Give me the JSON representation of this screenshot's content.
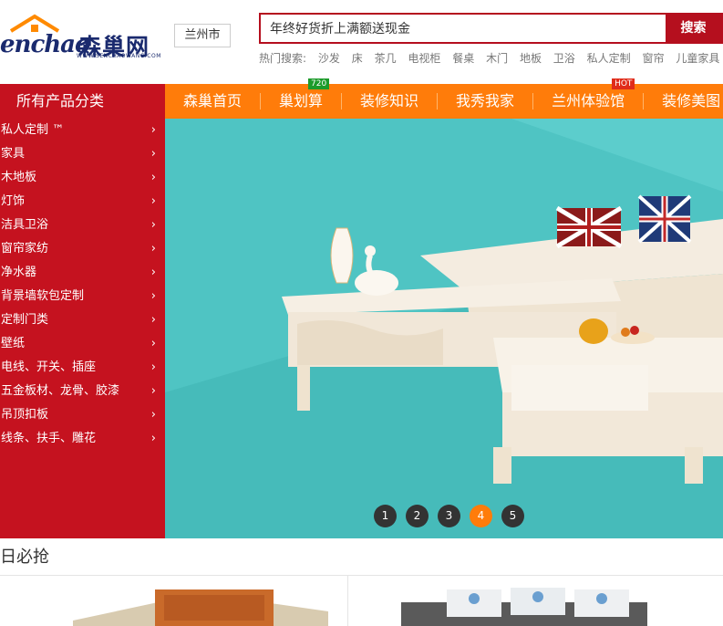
{
  "logo": {
    "english": "enchao",
    "chinese": "森巢网",
    "url": "WWW.SENCHAOWANG.COM"
  },
  "city": "兰州市",
  "search": {
    "value": "年终好货折上满额送现金",
    "button": "搜索"
  },
  "hot": {
    "label": "热门搜索:",
    "items": [
      "沙发",
      "床",
      "茶几",
      "电视柜",
      "餐桌",
      "木门",
      "地板",
      "卫浴",
      "私人定制",
      "窗帘",
      "儿童家具"
    ]
  },
  "nav": {
    "category_title": "所有产品分类",
    "items": [
      {
        "label": "森巢首页",
        "badge": ""
      },
      {
        "label": "巢划算",
        "badge": "720"
      },
      {
        "label": "装修知识",
        "badge": ""
      },
      {
        "label": "我秀我家",
        "badge": ""
      },
      {
        "label": "兰州体验馆",
        "badge": "HOT"
      },
      {
        "label": "装修美图",
        "badge": ""
      }
    ]
  },
  "categories": [
    "私人定制 ™",
    "家具",
    "木地板",
    "灯饰",
    "洁具卫浴",
    "窗帘家纺",
    "净水器",
    "背景墙软包定制",
    "定制门类",
    "壁纸",
    "电线、开关、插座",
    "五金板材、龙骨、胶漆",
    "吊顶扣板",
    "线条、扶手、雕花"
  ],
  "carousel": {
    "pages": [
      "1",
      "2",
      "3",
      "4",
      "5"
    ],
    "active_index": 3
  },
  "section": {
    "title": "日必抢"
  },
  "colors": {
    "brand_red": "#c5121f",
    "nav_orange": "#ff7c0a",
    "banner_teal": "#4fc4c3"
  }
}
